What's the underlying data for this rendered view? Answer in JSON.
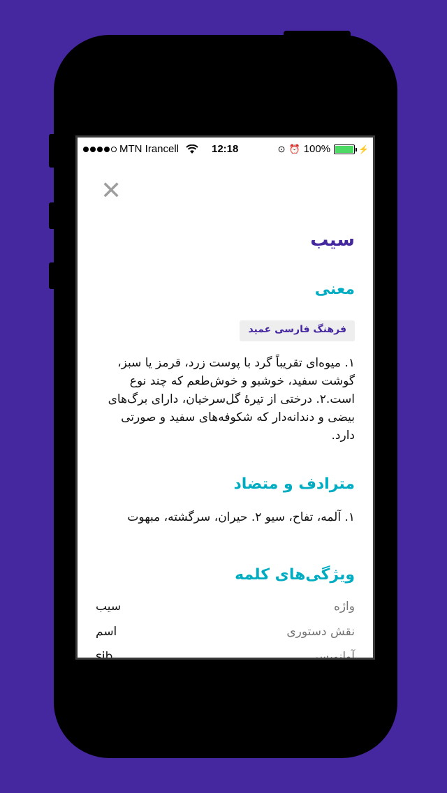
{
  "status_bar": {
    "carrier": "MTN Irancell",
    "time": "12:18",
    "battery": "100%"
  },
  "word": {
    "title": "سیب"
  },
  "meaning": {
    "heading": "معنی",
    "source": "فرهنگ فارسی عمید",
    "text": "۱. میوه‌ای تقریباً گرد با پوست زرد، قرمز یا سبز، گوشت سفید، خوشبو و خوش‌طعم که چند نوع است.۲. درختی از تیرۀ گل‌سرخیان، دارای برگ‌های بیضی و دندانه‌دار که شکوفه‌های سفید و صورتی دارد."
  },
  "synonyms": {
    "heading": "مترادف و متضاد",
    "text": "۱. آلمه، تفاح، سیو ۲. حیران، سرگشته، مبهوت"
  },
  "properties": {
    "heading": "ویژگی‌های کلمه",
    "rows": [
      {
        "label": "واژه",
        "value": "سیب"
      },
      {
        "label": "نقش دستوری",
        "value": "اسم"
      },
      {
        "label": "آوانویسی",
        "value": "sib"
      }
    ]
  }
}
